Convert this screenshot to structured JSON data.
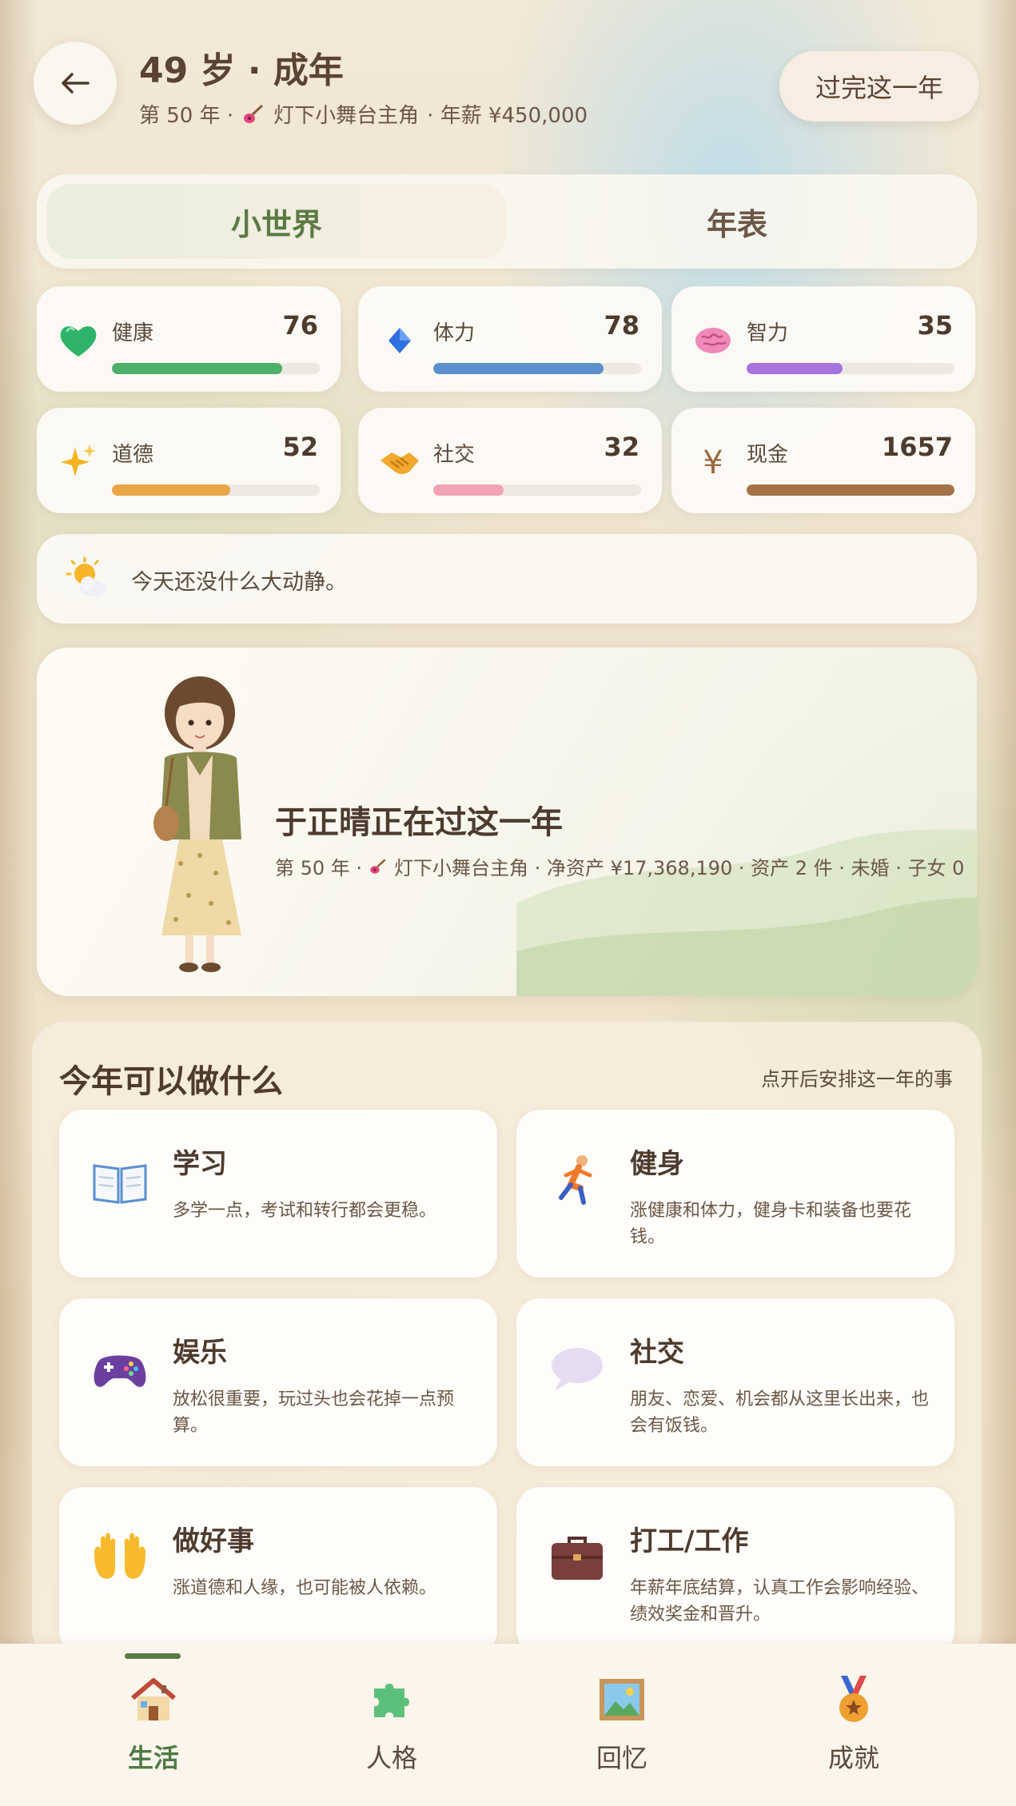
{
  "header": {
    "title": "49 岁 · 成年",
    "subtitle_year": "第 50 年 ·",
    "subtitle_job": "灯下小舞台主角",
    "subtitle_salary": "· 年薪 ¥450,000",
    "pass_button": "过完这一年"
  },
  "tabs": [
    {
      "label": "小世界",
      "active": true
    },
    {
      "label": "年表",
      "active": false
    }
  ],
  "stats": [
    {
      "label": "健康",
      "value": "76",
      "level": 0.82,
      "color": "#4caf6a",
      "icon": "green-heart-icon"
    },
    {
      "label": "体力",
      "value": "78",
      "level": 0.82,
      "color": "#5b8fce",
      "icon": "blue-diamond-icon"
    },
    {
      "label": "智力",
      "value": "35",
      "level": 0.46,
      "color": "#a873e0",
      "icon": "brain-icon"
    },
    {
      "label": "道德",
      "value": "52",
      "level": 0.57,
      "color": "#e8a646",
      "icon": "sparkles-icon"
    },
    {
      "label": "社交",
      "value": "32",
      "level": 0.34,
      "color": "#f2a2b5",
      "icon": "handshake-icon"
    },
    {
      "label": "现金",
      "value": "1657",
      "level": 1.0,
      "color": "#a57248",
      "icon": "yen-icon"
    }
  ],
  "message": {
    "text": "今天还没什么大动静。",
    "icon": "sun-behind-cloud-icon"
  },
  "character": {
    "name": "于正晴正在过这一年",
    "info_year": "第 50 年 ·",
    "info_rest": "灯下小舞台主角 · 净资产 ¥17,368,190 · 资产 2 件 · 未婚 · 子女 0"
  },
  "activities": {
    "title": "今年可以做什么",
    "hint": "点开后安排这一年的事",
    "items": [
      {
        "name": "学习",
        "desc": "多学一点，考试和转行都会更稳。",
        "icon": "open-book-icon"
      },
      {
        "name": "健身",
        "desc": "涨健康和体力，健身卡和装备也要花钱。",
        "icon": "running-person-icon"
      },
      {
        "name": "娱乐",
        "desc": "放松很重要，玩过头也会花掉一点预算。",
        "icon": "game-controller-icon"
      },
      {
        "name": "社交",
        "desc": "朋友、恋爱、机会都从这里长出来，也会有饭钱。",
        "icon": "speech-bubble-icon"
      },
      {
        "name": "做好事",
        "desc": "涨道德和人缘，也可能被人依赖。",
        "icon": "open-hands-icon"
      },
      {
        "name": "打工/工作",
        "desc": "年薪年底结算，认真工作会影响经验、绩效奖金和晋升。",
        "icon": "briefcase-icon"
      }
    ]
  },
  "nav": [
    {
      "label": "生活",
      "active": true,
      "icon": "house-icon"
    },
    {
      "label": "人格",
      "active": false,
      "icon": "puzzle-piece-icon"
    },
    {
      "label": "回忆",
      "active": false,
      "icon": "framed-picture-icon"
    },
    {
      "label": "成就",
      "active": false,
      "icon": "medal-icon"
    }
  ]
}
